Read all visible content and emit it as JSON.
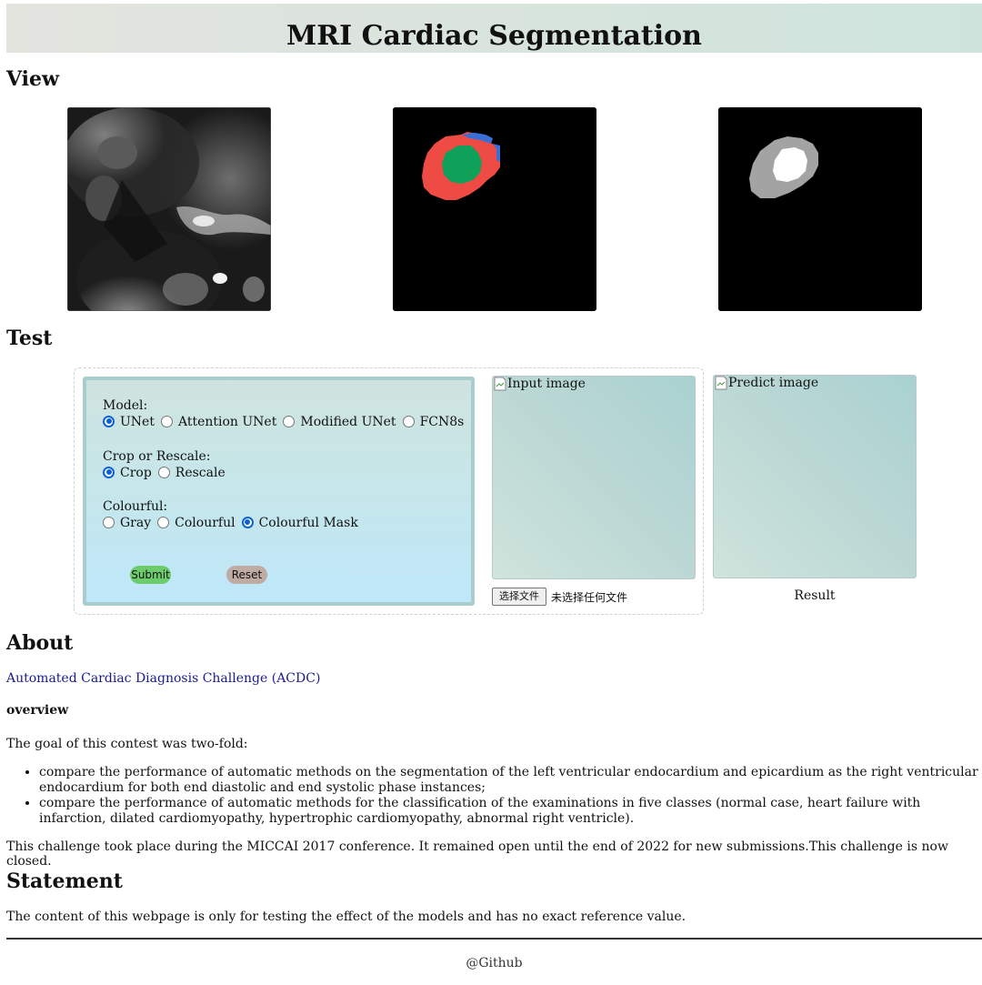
{
  "header": {
    "title": "MRI Cardiac Segmentation"
  },
  "view": {
    "heading": "View",
    "images": [
      {
        "name": "mri-input-image",
        "kind": "grayscale MRI slice"
      },
      {
        "name": "colour-mask-image",
        "kind": "colour segmentation mask"
      },
      {
        "name": "gray-mask-image",
        "kind": "grayscale segmentation mask"
      }
    ]
  },
  "test": {
    "heading": "Test",
    "model": {
      "label": "Model:",
      "options": [
        "UNet",
        "Attention UNet",
        "Modified UNet",
        "FCN8s"
      ],
      "selected": "UNet"
    },
    "crop": {
      "label": "Crop or Rescale:",
      "options": [
        "Crop",
        "Rescale"
      ],
      "selected": "Crop"
    },
    "colour": {
      "label": "Colourful:",
      "options": [
        "Gray",
        "Colourful",
        "Colourful Mask"
      ],
      "selected": "Colourful Mask"
    },
    "submit_label": "Submit",
    "reset_label": "Reset",
    "input_image_alt": "Input image",
    "predict_image_alt": "Predict image",
    "file_button_label": "选择文件",
    "file_status": "未选择任何文件",
    "result_label": "Result"
  },
  "about": {
    "heading": "About",
    "link_text": "Automated Cardiac Diagnosis Challenge (ACDC)",
    "overview_title": "overview",
    "goal_intro": "The goal of this contest was two-fold:",
    "goals": [
      "compare the performance of automatic methods on the segmentation of the left ventricular endocardium and epicardium as the right ventricular endocardium for both end diastolic and end systolic phase instances;",
      "compare the performance of automatic methods for the classification of the examinations in five classes (normal case, heart failure with infarction, dilated cardiomyopathy, hypertrophic cardiomyopathy, abnormal right ventricle)."
    ],
    "closing": "This challenge took place during the MICCAI 2017 conference. It remained open until the end of 2022 for new submissions.This challenge is now closed."
  },
  "statement": {
    "heading": "Statement",
    "text": "The content of this webpage is only for testing the effect of the models and has no exact reference value."
  },
  "footer": {
    "link_text": "@Github"
  },
  "colors": {
    "mask_red": "#ee4b44",
    "mask_green": "#0fa15a",
    "mask_blue": "#3a6fd8",
    "radio_accent": "#0b63d1",
    "submit_bg": "#6ccc6c",
    "reset_bg": "#bfaaa4"
  }
}
